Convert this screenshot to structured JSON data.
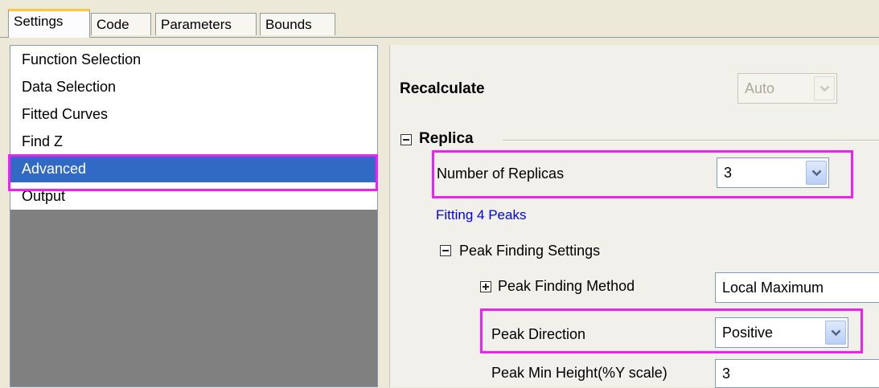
{
  "tabs": [
    {
      "label": "Settings",
      "active": true
    },
    {
      "label": "Code",
      "active": false
    },
    {
      "label": "Parameters",
      "active": false
    },
    {
      "label": "Bounds",
      "active": false
    }
  ],
  "nav": {
    "items": [
      {
        "label": "Function Selection",
        "selected": false
      },
      {
        "label": "Data Selection",
        "selected": false
      },
      {
        "label": "Fitted Curves",
        "selected": false
      },
      {
        "label": "Find Z",
        "selected": false
      },
      {
        "label": "Advanced",
        "selected": true
      },
      {
        "label": "Output",
        "selected": false
      }
    ]
  },
  "settings": {
    "recalculate": {
      "label": "Recalculate",
      "value": "Auto"
    },
    "replica_group": {
      "label": "Replica"
    },
    "number_of_replicas": {
      "label": "Number of Replicas",
      "value": "3"
    },
    "fitting_info": "Fitting 4 Peaks",
    "peak_finding_group": {
      "label": "Peak Finding Settings"
    },
    "peak_finding_method": {
      "label": "Peak Finding Method",
      "value": "Local Maximum"
    },
    "peak_direction": {
      "label": "Peak Direction",
      "value": "Positive"
    },
    "peak_min_height": {
      "label": "Peak Min Height(%Y scale)",
      "value": "3"
    }
  },
  "colors": {
    "highlight": "#ee22ee",
    "selection": "#316ac5",
    "link": "#0000ee"
  }
}
